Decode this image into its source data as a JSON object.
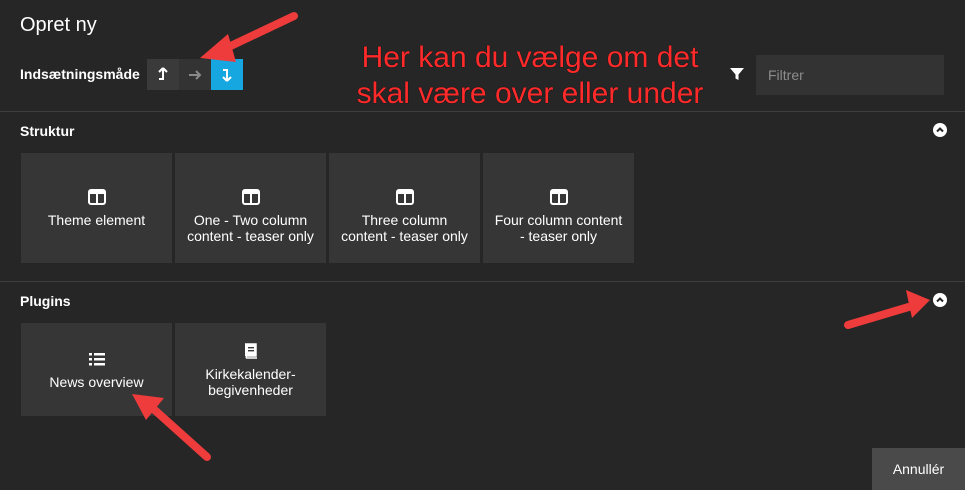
{
  "dialog": {
    "title": "Opret ny",
    "insert_mode_label": "Indsætningsmåde",
    "insert_mode_buttons": [
      {
        "icon": "insert-above-icon",
        "glyph": "⮥",
        "state": "normal"
      },
      {
        "icon": "insert-inline-icon",
        "glyph": "→",
        "state": "inactive"
      },
      {
        "icon": "insert-below-icon",
        "glyph": "⮧",
        "state": "selected"
      }
    ],
    "filter_placeholder": "Filtrer",
    "cancel_label": "Annullér"
  },
  "annotation": {
    "line1": "Her kan du vælge om det",
    "line2": "skal være over eller under",
    "color": "#ff2a2a"
  },
  "sections": [
    {
      "title": "Struktur",
      "tiles": [
        {
          "label": "Theme element",
          "icon": "columns-icon"
        },
        {
          "label": "One - Two column content - teaser only",
          "icon": "columns-icon"
        },
        {
          "label": "Three column content - teaser only",
          "icon": "columns-icon"
        },
        {
          "label": "Four column content - teaser only",
          "icon": "columns-icon"
        }
      ]
    },
    {
      "title": "Plugins",
      "tiles": [
        {
          "label": "News overview",
          "icon": "list-icon"
        },
        {
          "label": "Kirkekalender-begivenheder",
          "icon": "book-icon"
        }
      ]
    }
  ],
  "colors": {
    "background": "#262626",
    "tile": "#363636",
    "accent": "#16a6e0",
    "annotation_arrow": "#ee3b3b"
  }
}
